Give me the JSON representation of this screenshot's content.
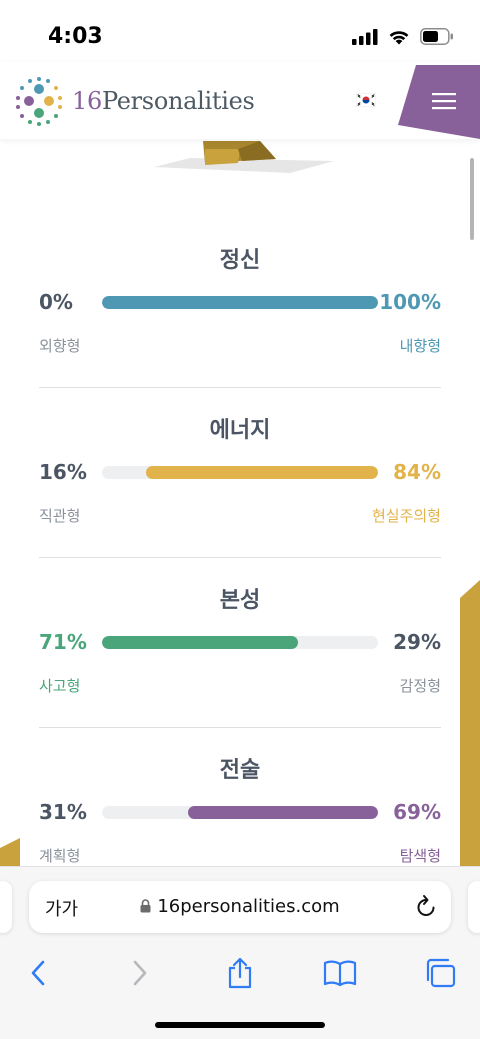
{
  "status": {
    "time": "4:03"
  },
  "header": {
    "logo_num": "16",
    "logo_word": "Personalities"
  },
  "colors": {
    "mind": "#4f98b3",
    "energy": "#e3b34b",
    "nature": "#4aa57a",
    "tactics": "#88619a",
    "track": "#eeeff1"
  },
  "traits": [
    {
      "title": "정신",
      "left_pct": "0%",
      "right_pct": "100%",
      "left_label": "외향형",
      "right_label": "내향형",
      "dominant": "right",
      "value": 100,
      "color": "#4f98b3"
    },
    {
      "title": "에너지",
      "left_pct": "16%",
      "right_pct": "84%",
      "left_label": "직관형",
      "right_label": "현실주의형",
      "dominant": "right",
      "value": 84,
      "color": "#e3b34b"
    },
    {
      "title": "본성",
      "left_pct": "71%",
      "right_pct": "29%",
      "left_label": "사고형",
      "right_label": "감정형",
      "dominant": "left",
      "value": 71,
      "color": "#4aa57a"
    },
    {
      "title": "전술",
      "left_pct": "31%",
      "right_pct": "69%",
      "left_label": "계획형",
      "right_label": "탐색형",
      "dominant": "right",
      "value": 69,
      "color": "#88619a"
    }
  ],
  "browser": {
    "aa_label": "가가",
    "url": "16personalities.com"
  },
  "icons": {
    "signal": "signal-icon",
    "wifi": "wifi-icon",
    "battery": "battery-icon",
    "flag": "korea-flag-icon",
    "menu": "hamburger-menu-icon",
    "lock": "lock-icon",
    "reload": "reload-icon",
    "back": "chevron-left-icon",
    "forward": "chevron-right-icon",
    "share": "share-icon",
    "bookmarks": "book-icon",
    "tabs": "tabs-icon"
  }
}
